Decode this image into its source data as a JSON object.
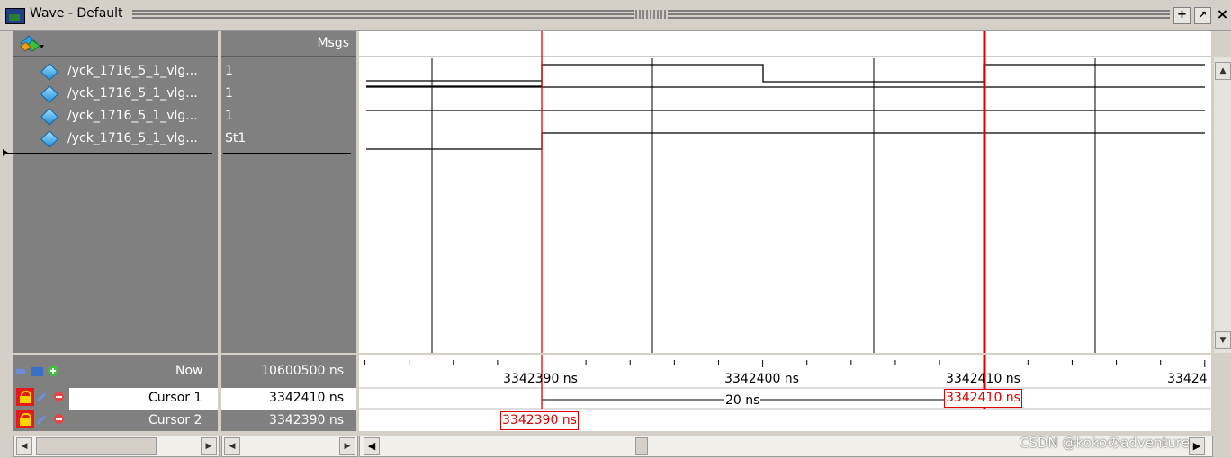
{
  "window": {
    "title": "Wave - Default",
    "buttons": {
      "dock": "+",
      "undock": "↗",
      "close": "×"
    }
  },
  "header": {
    "msgs_label": "Msgs"
  },
  "signals": [
    {
      "name": "/yck_1716_5_1_vlg...",
      "value": "1"
    },
    {
      "name": "/yck_1716_5_1_vlg...",
      "value": "1"
    },
    {
      "name": "/yck_1716_5_1_vlg...",
      "value": "1"
    },
    {
      "name": "/yck_1716_5_1_vlg...",
      "value": "St1"
    }
  ],
  "status": {
    "now_label": "Now",
    "now_value": "10600500 ns",
    "cursor1_label": "Cursor 1",
    "cursor1_value": "3342410 ns",
    "cursor2_label": "Cursor 2",
    "cursor2_value": "3342390 ns"
  },
  "timeline": {
    "ticks": [
      {
        "label": "3342390 ns",
        "t": 3342390
      },
      {
        "label": "3342400 ns",
        "t": 3342400
      },
      {
        "label": "3342410 ns",
        "t": 3342410
      },
      {
        "label": "33424",
        "t": 3342420
      }
    ],
    "cursor1_time": 3342410,
    "cursor2_time": 3342390,
    "delta_label": "20 ns",
    "cursor1_box": "3342410 ns",
    "cursor2_box": "3342390 ns"
  },
  "watermark": "CSDN @kokoのadventure",
  "colors": {
    "cursor": "#e00000",
    "pane_bg": "#808080",
    "wave_bg": "#ffffff"
  },
  "icons": [
    "wave-window-icon",
    "diamond-signal-icon",
    "lock-icon",
    "wrench-icon",
    "minus-circle-icon",
    "add-cursor-icon"
  ]
}
